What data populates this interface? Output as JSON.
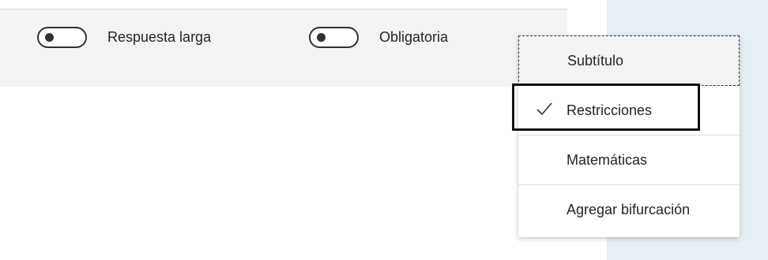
{
  "toolbar": {
    "long_answer_label": "Respuesta larga",
    "required_label": "Obligatoria"
  },
  "menu": {
    "items": [
      {
        "label": "Subtítulo",
        "checked": false
      },
      {
        "label": "Restricciones",
        "checked": true
      },
      {
        "label": "Matemáticas",
        "checked": false
      },
      {
        "label": "Agregar bifurcación",
        "checked": false
      }
    ],
    "check_icon": "checkmark-icon"
  },
  "colors": {
    "toolbar_bg": "#f3f3f3",
    "side_panel_bg": "#e6eff4",
    "text": "#252423"
  }
}
